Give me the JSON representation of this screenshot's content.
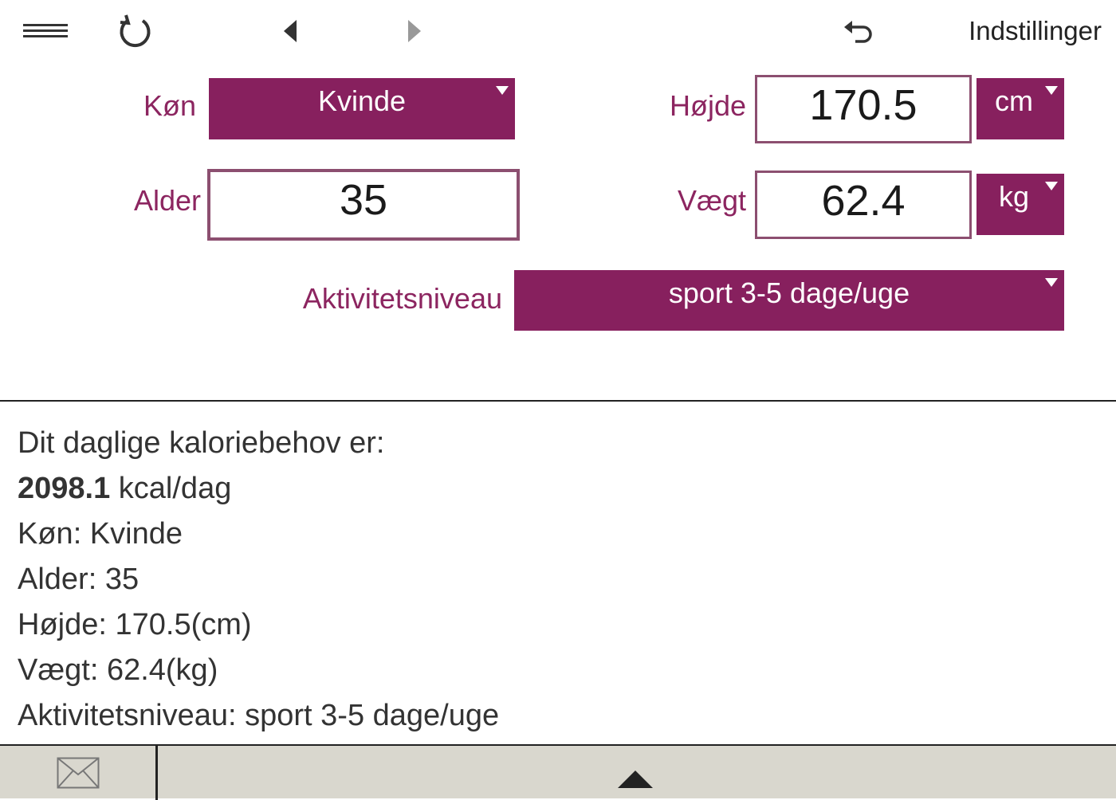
{
  "toolbar": {
    "menu_icon": "hamburger-menu-icon",
    "refresh_icon": "refresh-icon",
    "back_icon": "triangle-left-icon",
    "forward_icon": "triangle-right-icon",
    "undo_icon": "undo-icon",
    "settings_label": "Indstillinger"
  },
  "form": {
    "gender": {
      "label": "Køn",
      "value": "Kvinde"
    },
    "age": {
      "label": "Alder",
      "value": "35"
    },
    "height": {
      "label": "Højde",
      "value": "170.5",
      "unit": "cm"
    },
    "weight": {
      "label": "Vægt",
      "value": "62.4",
      "unit": "kg"
    },
    "activity": {
      "label": "Aktivitetsniveau",
      "value": "sport 3-5 dage/uge"
    }
  },
  "results": {
    "heading": "Dit daglige kaloriebehov er:",
    "calories_value": "2098.1",
    "calories_unit": "kcal/dag",
    "gender_line": "Køn: Kvinde",
    "age_line": "Alder: 35",
    "height_line": "Højde: 170.5(cm)",
    "weight_line": "Vægt: 62.4(kg)",
    "activity_line": "Aktivitetsniveau: sport 3-5 dage/uge"
  },
  "bottom_bar": {
    "mail_icon": "envelope-icon",
    "expand_icon": "triangle-up-icon"
  },
  "colors": {
    "accent": "#87205e",
    "label": "#8c2560",
    "input_border": "#8c4f70",
    "bottom_bar": "#d9d7ce"
  }
}
